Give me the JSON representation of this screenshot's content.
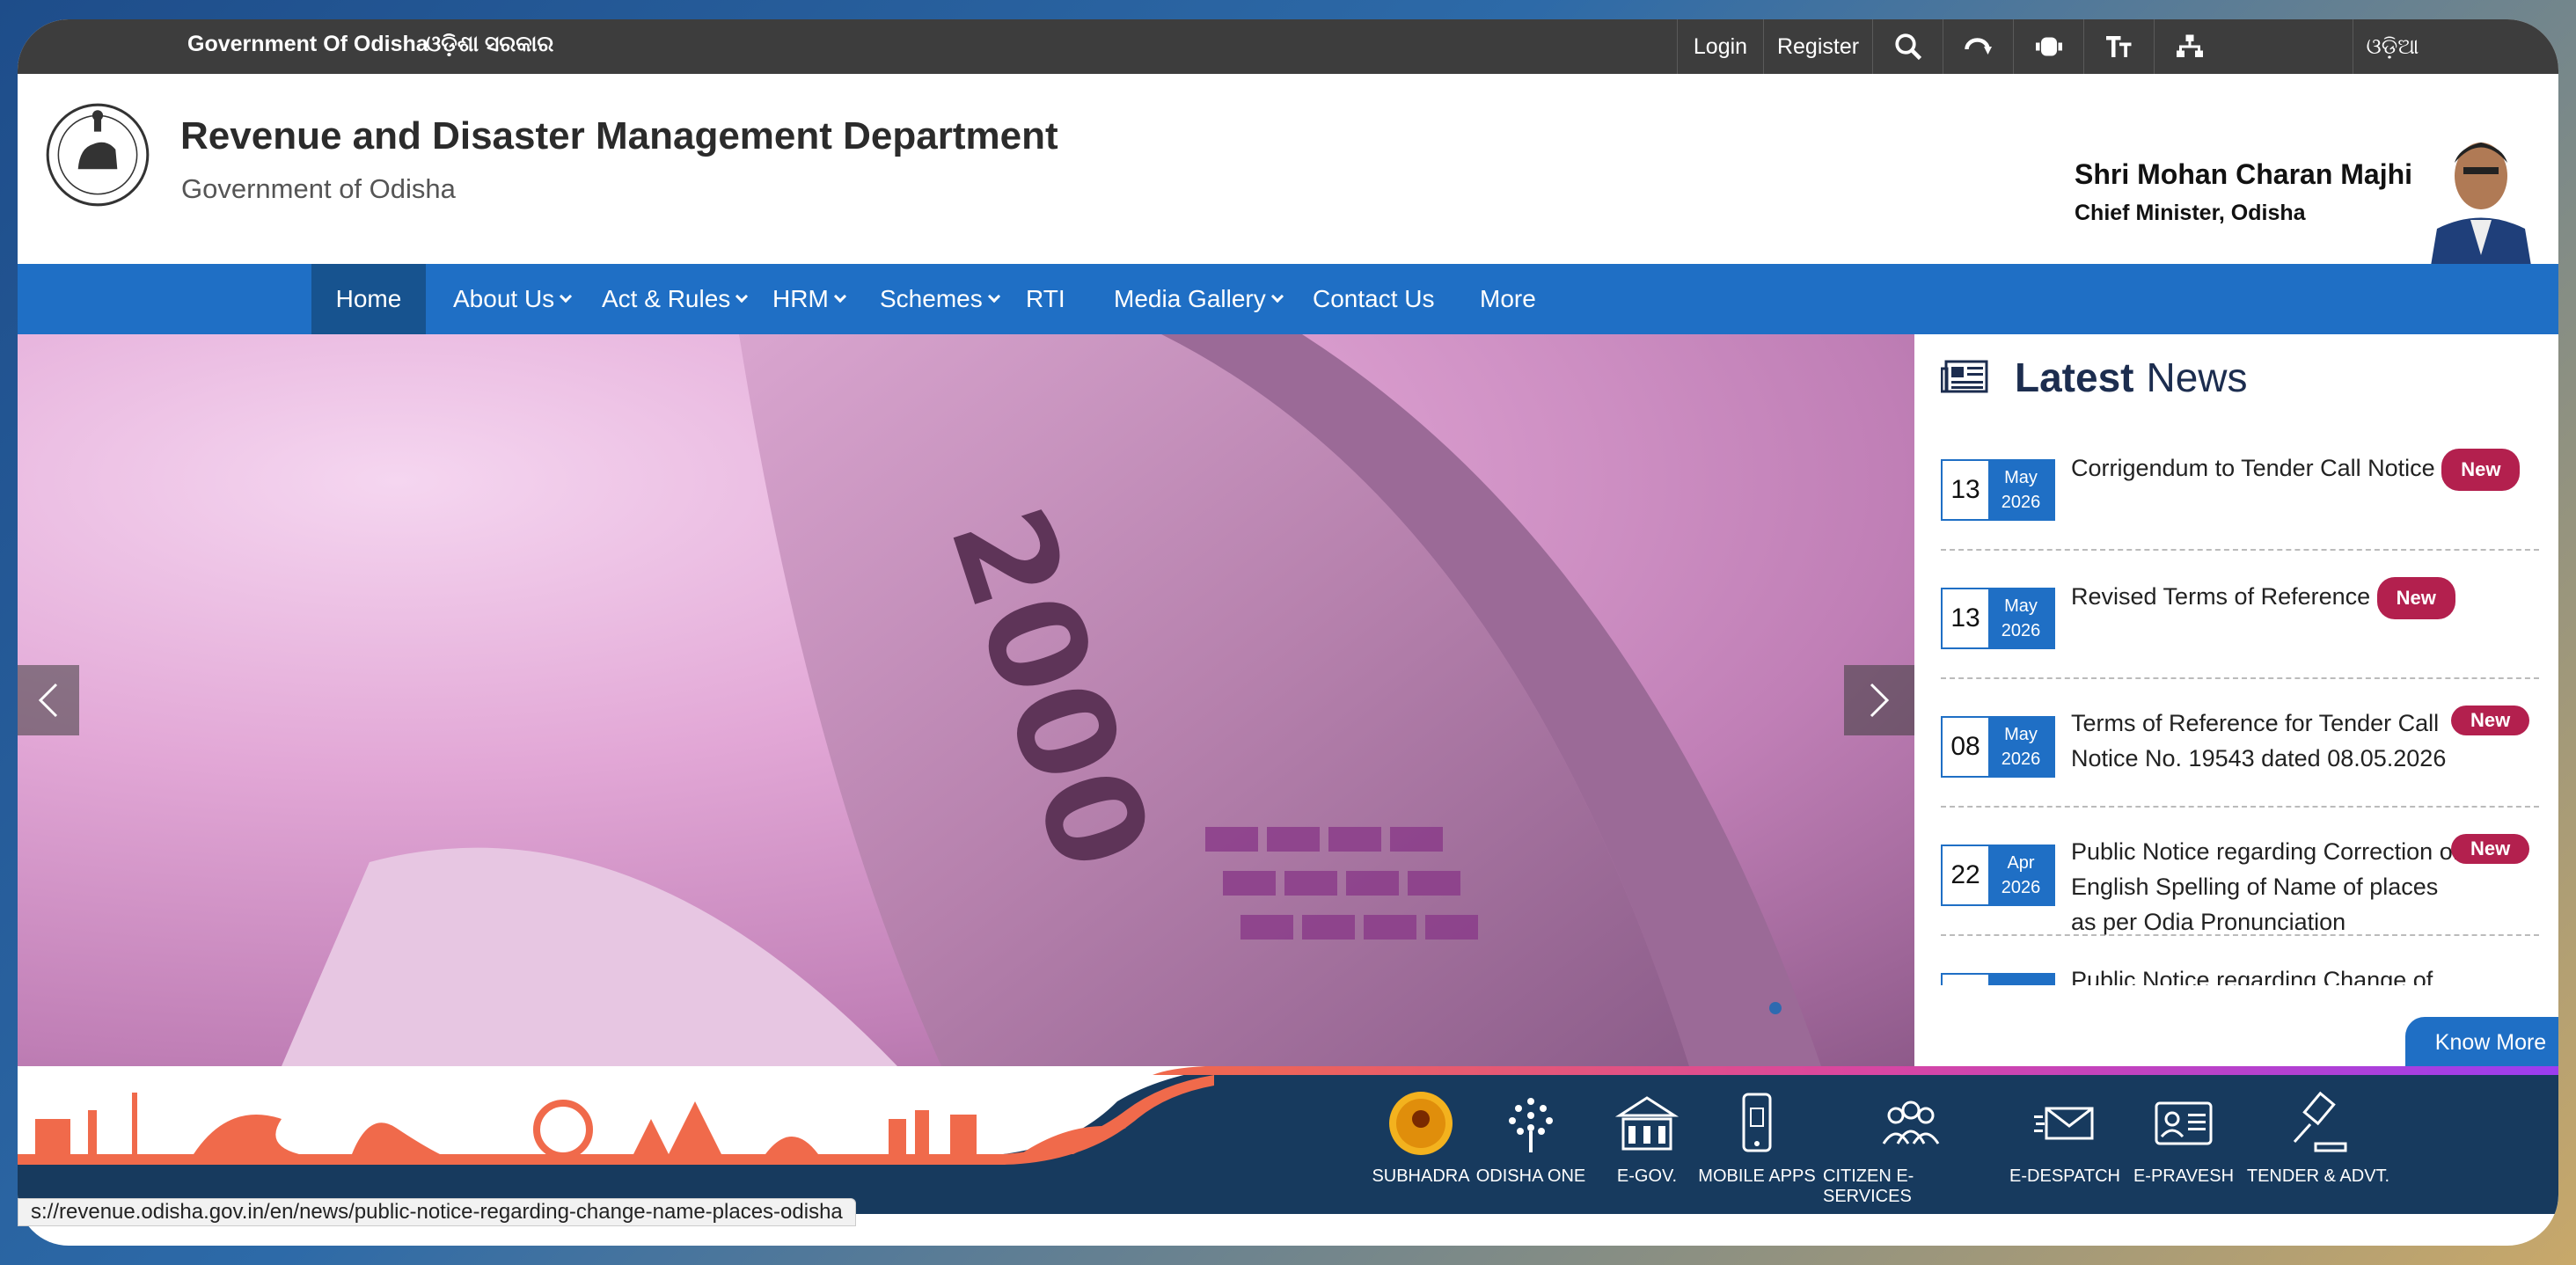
{
  "topbar": {
    "gov": "Government Of Odisha",
    "odia_gov": "ଓଡ଼ିଶା ସରକାର",
    "login": "Login",
    "register": "Register",
    "language": "ଓଡ଼ିଆ",
    "icons": [
      "search-icon",
      "screen-reader-icon",
      "contrast-icon",
      "text-size-icon",
      "sitemap-icon"
    ]
  },
  "header": {
    "title": "Revenue and Disaster Management Department",
    "subtitle": "Government of Odisha",
    "cm_name": "Shri Mohan Charan Majhi",
    "cm_role": "Chief Minister, Odisha"
  },
  "nav": [
    {
      "label": "Home",
      "active": true
    },
    {
      "label": "About Us",
      "dropdown": true
    },
    {
      "label": "Act & Rules",
      "dropdown": true
    },
    {
      "label": "HRM",
      "dropdown": true
    },
    {
      "label": "Schemes",
      "dropdown": true
    },
    {
      "label": "RTI"
    },
    {
      "label": "Media Gallery",
      "dropdown": true
    },
    {
      "label": "Contact Us"
    },
    {
      "label": "More"
    }
  ],
  "hero": {
    "banknote_text": "2000"
  },
  "news": {
    "title_bold": "Latest",
    "title_rest": "News",
    "items": [
      {
        "day": "13",
        "month": "May",
        "year": "2026",
        "text": "Corrigendum to Tender Call Notice",
        "badge": "New"
      },
      {
        "day": "13",
        "month": "May",
        "year": "2026",
        "text": "Revised Terms of Reference",
        "badge": "New"
      },
      {
        "day": "08",
        "month": "May",
        "year": "2026",
        "text": "Terms of Reference for Tender Call Notice No. 19543 dated 08.05.2026",
        "badge": "New"
      },
      {
        "day": "22",
        "month": "Apr",
        "year": "2026",
        "text": "Public Notice regarding Correction of English Spelling of Name of places as per Odia Pronunciation",
        "badge": "New"
      },
      {
        "day": "",
        "month": "",
        "year": "",
        "text": "Public Notice regarding Change of name of",
        "badge": ""
      }
    ],
    "know_more": "Know More"
  },
  "services": [
    {
      "label": "SUBHADRA",
      "icon": "subhadra-logo-icon"
    },
    {
      "label": "ODISHA ONE",
      "icon": "odisha-one-icon"
    },
    {
      "label": "E-GOV.",
      "icon": "egov-building-icon"
    },
    {
      "label": "MOBILE APPS",
      "icon": "mobile-apps-icon"
    },
    {
      "label": "CITIZEN E-SERVICES",
      "icon": "citizen-services-icon"
    },
    {
      "label": "E-DESPATCH",
      "icon": "e-despatch-icon"
    },
    {
      "label": "E-PRAVESH",
      "icon": "e-pravesh-icon"
    },
    {
      "label": "TENDER & ADVT.",
      "icon": "tender-gavel-icon"
    }
  ],
  "status_url": "s://revenue.odisha.gov.in/en/news/public-notice-regarding-change-name-places-odisha",
  "colors": {
    "nav_blue": "#1f6fc5",
    "navy": "#173a5e",
    "badge": "#b3204e",
    "topbar": "#3d3d3d"
  }
}
